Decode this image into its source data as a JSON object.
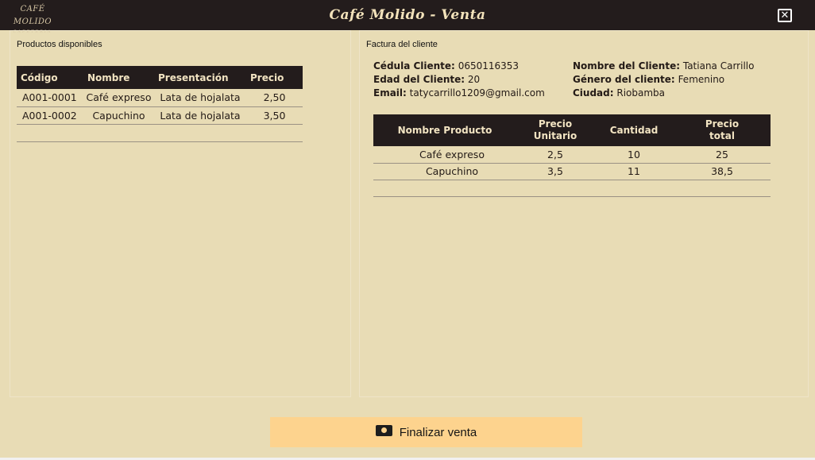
{
  "window": {
    "title": "Café Molido - Venta",
    "logo_line1": "CAFÉ MOLIDO",
    "logo_line2": "CAFETERIA",
    "close_icon": "close-icon"
  },
  "products_panel": {
    "label": "Productos disponibles",
    "columns": [
      "Código",
      "Nombre",
      "Presentación",
      "Precio"
    ],
    "rows": [
      [
        "A001-0001",
        "Café expreso",
        "Lata de hojalata",
        "2,50"
      ],
      [
        "A001-0002",
        "Capuchino",
        "Lata de hojalata",
        "3,50"
      ]
    ]
  },
  "invoice_panel": {
    "label": "Factura del cliente",
    "client": {
      "cedula_label": "Cédula Cliente:",
      "cedula": "0650116353",
      "edad_label": "Edad del Cliente:",
      "edad": "20",
      "email_label": "Email:",
      "email": "tatycarrillo1209@gmail.com",
      "nombre_label": "Nombre del Cliente:",
      "nombre": "Tatiana Carrillo",
      "genero_label": "Género del cliente:",
      "genero": "Femenino",
      "ciudad_label": "Ciudad:",
      "ciudad": "Riobamba"
    },
    "columns": [
      "Nombre Producto",
      "Precio Unitario",
      "Cantidad",
      "Precio total"
    ],
    "rows": [
      [
        "Café expreso",
        "2,5",
        "10",
        "25"
      ],
      [
        "Capuchino",
        "3,5",
        "11",
        "38,5"
      ]
    ]
  },
  "actions": {
    "finalize_label": "Finalizar venta",
    "finalize_icon": "money-icon"
  },
  "colors": {
    "background": "#e8dcb5",
    "titlebar": "#231c1c",
    "button": "#fdd38e"
  }
}
